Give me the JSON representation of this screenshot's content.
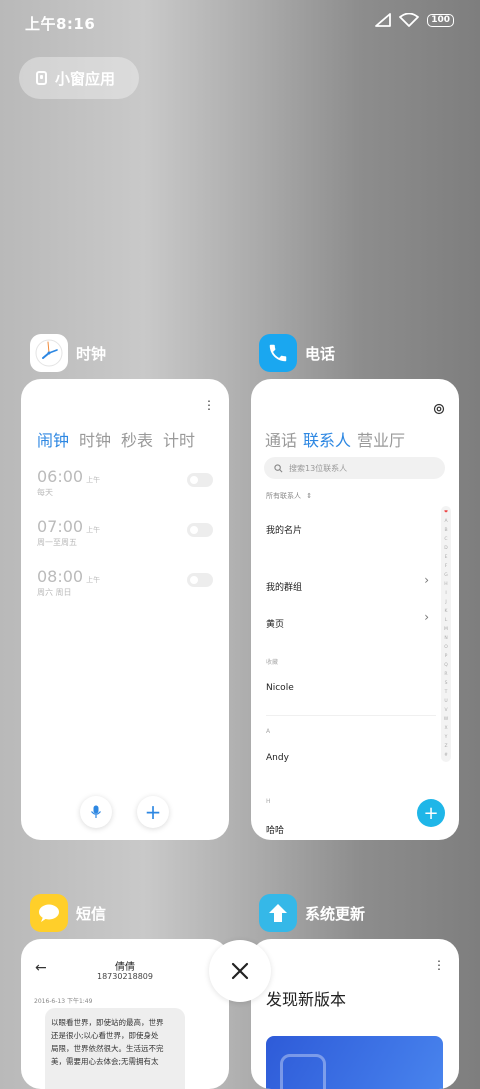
{
  "status": {
    "time": "上午8:16",
    "battery": "100"
  },
  "pill": {
    "label": "小窗应用"
  },
  "apps": {
    "clock": {
      "name": "时钟",
      "tabs": [
        "闹钟",
        "时钟",
        "秒表",
        "计时"
      ],
      "alarms": [
        {
          "time": "06:00",
          "ampm": "上午",
          "repeat": "每天"
        },
        {
          "time": "07:00",
          "ampm": "上午",
          "repeat": "周一至周五"
        },
        {
          "time": "08:00",
          "ampm": "上午",
          "repeat": "周六 周日"
        }
      ]
    },
    "phone": {
      "name": "电话",
      "tabs": [
        "通话",
        "联系人",
        "营业厅"
      ],
      "search_placeholder": "搜索13位联系人",
      "filter": "所有联系人",
      "my_card": "我的名片",
      "my_groups": "我的群组",
      "yellow_pages": "黄页",
      "favorites_header": "收藏",
      "favorite_contact": "Nicole",
      "section_a": "A",
      "contact_a": "Andy",
      "section_h": "H",
      "contact_h": "哈哈",
      "alphabet": [
        "❤",
        "A",
        "B",
        "C",
        "D",
        "E",
        "F",
        "G",
        "H",
        "I",
        "J",
        "K",
        "L",
        "M",
        "N",
        "O",
        "P",
        "Q",
        "R",
        "S",
        "T",
        "U",
        "V",
        "W",
        "X",
        "Y",
        "Z",
        "#"
      ]
    },
    "sms": {
      "name": "短信",
      "contact_name": "倩倩",
      "contact_number": "18730218809",
      "timestamp": "2016-6-13 下午1:49",
      "message_lines": [
        "以眼看世界，即使站的最高，世界",
        "还是很小;以心看世界，即使身处",
        "局限，世界依然很大。生活远不完",
        "美，需要用心去体会;无需拥有太"
      ]
    },
    "update": {
      "name": "系统更新",
      "headline": "发现新版本"
    }
  },
  "colors": {
    "accent": "#2d87e2",
    "fab": "#1fb6e8",
    "sms_icon": "#ffcf2a",
    "update_icon": "#35b8e8"
  }
}
